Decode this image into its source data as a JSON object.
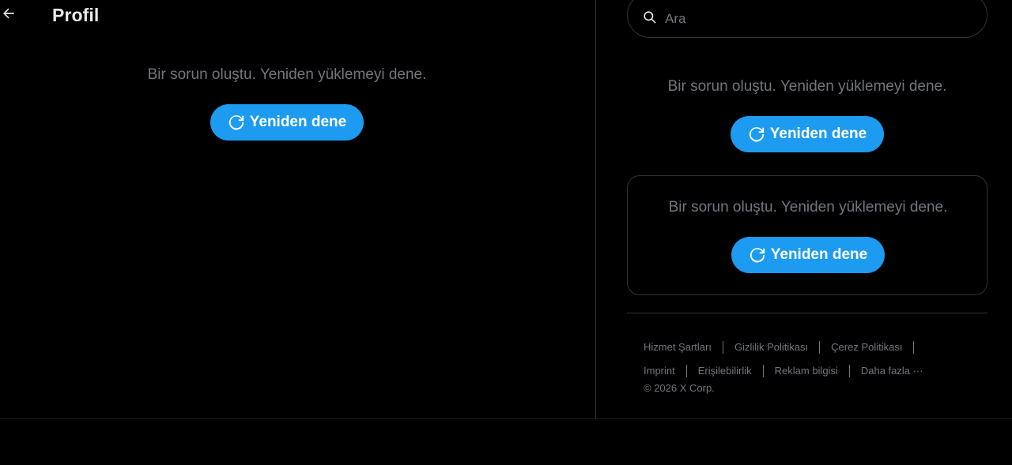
{
  "header": {
    "title": "Profil",
    "back_icon": "arrow-left-icon"
  },
  "main": {
    "error_text": "Bir sorun oluştu. Yeniden yüklemeyi dene.",
    "retry_label": "Yeniden dene"
  },
  "search": {
    "placeholder": "Ara",
    "icon": "search-icon"
  },
  "sidebar": {
    "block1": {
      "error_text": "Bir sorun oluştu. Yeniden yüklemeyi dene.",
      "retry_label": "Yeniden dene"
    },
    "block2": {
      "error_text": "Bir sorun oluştu. Yeniden yüklemeyi dene.",
      "retry_label": "Yeniden dene"
    }
  },
  "footer": {
    "links": [
      "Hizmet Şartları",
      "Gizlilik Politikası",
      "Çerez Politikası",
      "Imprint",
      "Erişilebilirlik",
      "Reklam bilgisi",
      "Daha fazla ···"
    ],
    "copyright": "© 2026 X Corp."
  },
  "colors": {
    "background": "#000000",
    "accent": "#1d9bf0",
    "text_primary": "#e7e9ea",
    "text_secondary": "#71767b",
    "border": "#2f3336"
  }
}
